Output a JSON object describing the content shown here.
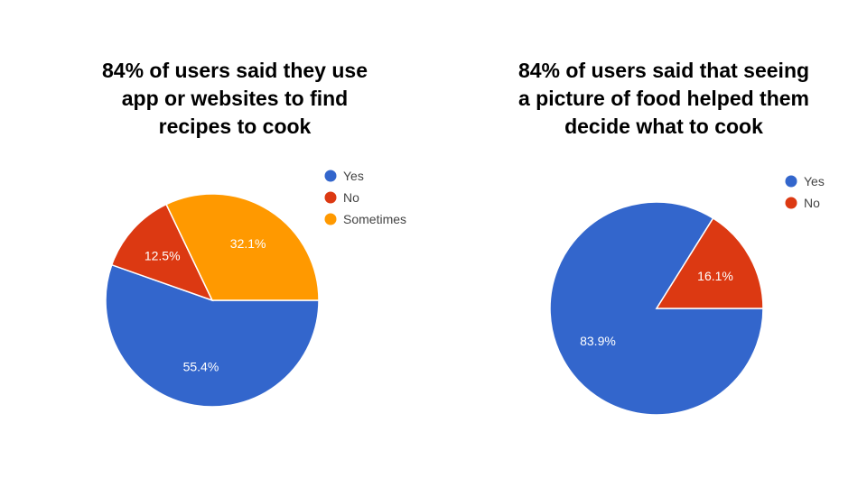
{
  "slide": {
    "left_title": [
      "84% of users said they use",
      "app or websites to find",
      "recipes to cook"
    ],
    "right_title": [
      "84% of users said that seeing",
      "a picture of food helped them",
      "decide what to cook"
    ]
  },
  "chart_data": [
    {
      "type": "pie",
      "title": "84% of users said they use app or websites to find recipes to cook",
      "categories": [
        "Yes",
        "No",
        "Sometimes"
      ],
      "values": [
        55.4,
        12.5,
        32.1
      ],
      "labels": [
        "55.4%",
        "12.5%",
        "32.1%"
      ],
      "colors": [
        "#3366cc",
        "#dc3912",
        "#ff9900"
      ],
      "legend": "right"
    },
    {
      "type": "pie",
      "title": "84% of users said that seeing a picture of food helped them decide what to cook",
      "categories": [
        "Yes",
        "No"
      ],
      "values": [
        83.9,
        16.1
      ],
      "labels": [
        "83.9%",
        "16.1%"
      ],
      "colors": [
        "#3366cc",
        "#dc3912"
      ],
      "legend": "right"
    }
  ]
}
